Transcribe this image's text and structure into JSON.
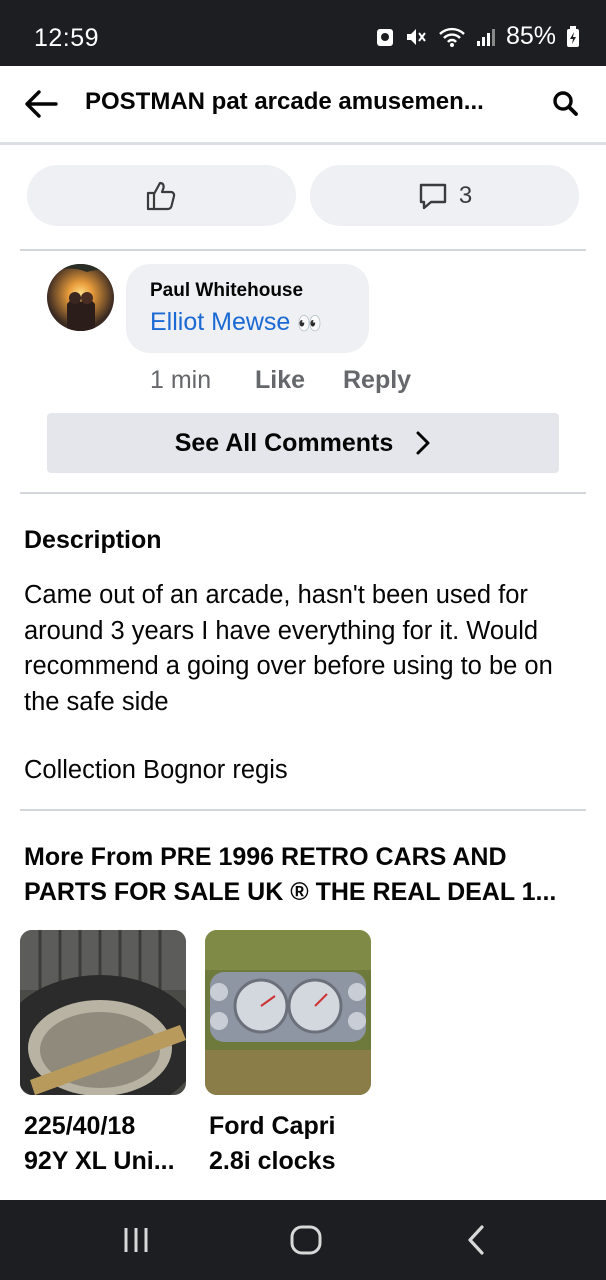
{
  "status": {
    "time": "12:59",
    "battery": "85%"
  },
  "header": {
    "title": "POSTMAN pat arcade amusemen...",
    "back_icon": "arrow-left-icon",
    "search_icon": "search-icon"
  },
  "actions": {
    "like_icon": "thumbs-up-icon",
    "comment_icon": "comment-icon",
    "comment_count": "3"
  },
  "comment": {
    "author": "Paul Whitehouse",
    "mention": "Elliot Mewse",
    "emoji": "👀",
    "time": "1 min",
    "like_label": "Like",
    "reply_label": "Reply"
  },
  "see_all": {
    "label": "See All Comments",
    "icon": "chevron-right-icon"
  },
  "description": {
    "heading": "Description",
    "body": "Came out of an arcade, hasn't been used for around 3 years I have everything for it. Would recommend a going over before using to be on the safe side",
    "collection": "Collection Bognor regis"
  },
  "more": {
    "heading_line1": "More From PRE 1996 RETRO CARS AND",
    "heading_line2": "PARTS FOR SALE UK ® THE REAL DEAL 1...",
    "items": [
      {
        "line1": "225/40/18",
        "line2": "92Y XL Uni..."
      },
      {
        "line1": "Ford Capri",
        "line2": "2.8i clocks"
      }
    ]
  },
  "nav": {
    "recents_icon": "recents-icon",
    "home_icon": "home-icon",
    "back_icon": "back-icon"
  }
}
